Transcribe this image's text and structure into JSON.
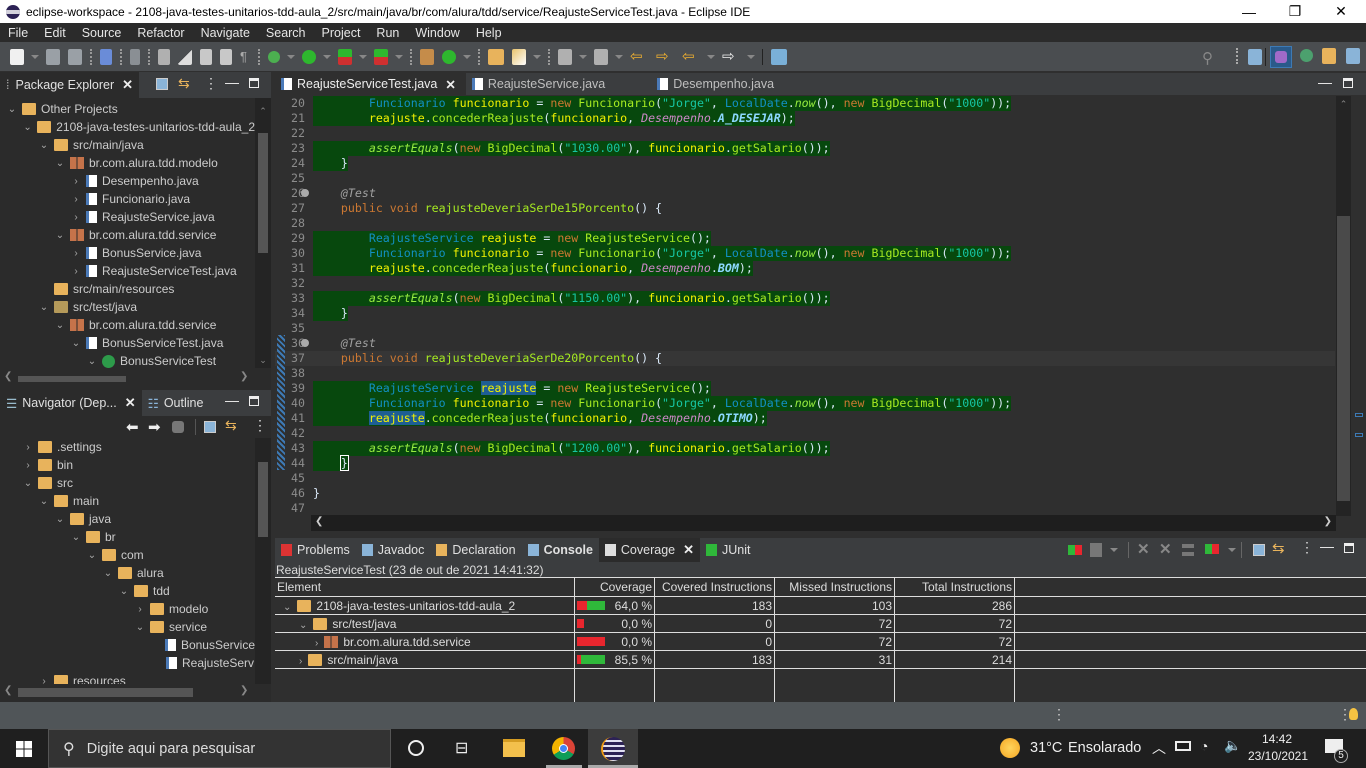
{
  "window": {
    "title": "eclipse-workspace - 2108-java-testes-unitarios-tdd-aula_2/src/main/java/br/com/alura/tdd/service/ReajusteServiceTest.java - Eclipse IDE",
    "minimize": "—",
    "maximize": "❐",
    "close": "✕"
  },
  "menu": [
    "File",
    "Edit",
    "Source",
    "Refactor",
    "Navigate",
    "Search",
    "Project",
    "Run",
    "Window",
    "Help"
  ],
  "package_explorer": {
    "title": "Package Explorer",
    "items": [
      {
        "label": "Other Projects",
        "depth": 0,
        "chev": "v",
        "icon": "working-set"
      },
      {
        "label": "2108-java-testes-unitarios-tdd-aula_2",
        "depth": 1,
        "chev": "v",
        "icon": "project"
      },
      {
        "label": "src/main/java",
        "depth": 2,
        "chev": "v",
        "icon": "source-folder"
      },
      {
        "label": "br.com.alura.tdd.modelo",
        "depth": 3,
        "chev": "v",
        "icon": "package"
      },
      {
        "label": "Desempenho.java",
        "depth": 4,
        "chev": ">",
        "icon": "java-enum-file"
      },
      {
        "label": "Funcionario.java",
        "depth": 4,
        "chev": ">",
        "icon": "java-file"
      },
      {
        "label": "ReajusteService.java",
        "depth": 4,
        "chev": ">",
        "icon": "java-file"
      },
      {
        "label": "br.com.alura.tdd.service",
        "depth": 3,
        "chev": "v",
        "icon": "package"
      },
      {
        "label": "BonusService.java",
        "depth": 4,
        "chev": ">",
        "icon": "java-file"
      },
      {
        "label": "ReajusteServiceTest.java",
        "depth": 4,
        "chev": ">",
        "icon": "java-file"
      },
      {
        "label": "src/main/resources",
        "depth": 2,
        "chev": "",
        "icon": "source-folder"
      },
      {
        "label": "src/test/java",
        "depth": 2,
        "chev": "v",
        "icon": "test-folder"
      },
      {
        "label": "br.com.alura.tdd.service",
        "depth": 3,
        "chev": "v",
        "icon": "package"
      },
      {
        "label": "BonusServiceTest.java",
        "depth": 4,
        "chev": "v",
        "icon": "java-test-file"
      },
      {
        "label": "BonusServiceTest",
        "depth": 5,
        "chev": "v",
        "icon": "class"
      }
    ]
  },
  "navigator": {
    "title": "Navigator (Dep...",
    "outline_tab": "Outline",
    "items": [
      {
        "label": ".settings",
        "depth": 0,
        "chev": ">",
        "icon": "folder"
      },
      {
        "label": "bin",
        "depth": 0,
        "chev": ">",
        "icon": "folder"
      },
      {
        "label": "src",
        "depth": 0,
        "chev": "v",
        "icon": "folder"
      },
      {
        "label": "main",
        "depth": 1,
        "chev": "v",
        "icon": "folder"
      },
      {
        "label": "java",
        "depth": 2,
        "chev": "v",
        "icon": "folder"
      },
      {
        "label": "br",
        "depth": 3,
        "chev": "v",
        "icon": "folder"
      },
      {
        "label": "com",
        "depth": 4,
        "chev": "v",
        "icon": "folder"
      },
      {
        "label": "alura",
        "depth": 5,
        "chev": "v",
        "icon": "folder"
      },
      {
        "label": "tdd",
        "depth": 6,
        "chev": "v",
        "icon": "folder"
      },
      {
        "label": "modelo",
        "depth": 7,
        "chev": ">",
        "icon": "folder"
      },
      {
        "label": "service",
        "depth": 7,
        "chev": "v",
        "icon": "folder"
      },
      {
        "label": "BonusService",
        "depth": 8,
        "chev": "",
        "icon": "java-file"
      },
      {
        "label": "ReajusteServ",
        "depth": 8,
        "chev": "",
        "icon": "java-file"
      },
      {
        "label": "resources",
        "depth": 1,
        "chev": ">",
        "icon": "folder"
      }
    ]
  },
  "editor": {
    "tabs": [
      {
        "label": "ReajusteServiceTest.java",
        "active": true
      },
      {
        "label": "ReajusteService.java",
        "active": false
      },
      {
        "label": "Desempenho.java",
        "active": false
      }
    ],
    "lines": [
      {
        "n": "20",
        "cov": true,
        "html": "        <span class='t'>Funcionario</span> <span class='v'>funcionario</span> = <span class='k'>new</span> <span class='m'>Funcionario</span>(<span class='s'>\"Jorge\"</span>, <span class='t'>LocalDate</span>.<span class='st'>now</span>(), <span class='k'>new</span> <span class='m'>BigDecimal</span>(<span class='s'>\"1000\"</span>));"
      },
      {
        "n": "21",
        "cov": true,
        "html": "        <span class='v'>reajuste</span>.<span class='m'>concederReajuste</span>(<span class='v'>funcionario</span>, <span class='e'>Desempenho</span>.<span class='f'>A_DESEJAR</span>);"
      },
      {
        "n": "22",
        "cov": false,
        "html": ""
      },
      {
        "n": "23",
        "cov": true,
        "html": "        <span class='st'>assertEquals</span>(<span class='k'>new</span> <span class='m'>BigDecimal</span>(<span class='s'>\"1030.00\"</span>), <span class='v'>funcionario</span>.<span class='m'>getSalario</span>());"
      },
      {
        "n": "24",
        "cov": true,
        "html": "    }"
      },
      {
        "n": "25",
        "cov": false,
        "html": ""
      },
      {
        "n": "26",
        "cov": false,
        "fold": true,
        "html": "    <span class='an'>@Test</span>"
      },
      {
        "n": "27",
        "cov": false,
        "html": "    <span class='k'>public</span> <span class='k'>void</span> <span class='m'>reajusteDeveriaSerDe15Porcento</span>() {"
      },
      {
        "n": "28",
        "cov": false,
        "html": ""
      },
      {
        "n": "29",
        "cov": true,
        "html": "        <span class='t'>ReajusteService</span> <span class='v'>reajuste</span> = <span class='k'>new</span> <span class='m'>ReajusteService</span>();"
      },
      {
        "n": "30",
        "cov": true,
        "html": "        <span class='t'>Funcionario</span> <span class='v'>funcionario</span> = <span class='k'>new</span> <span class='m'>Funcionario</span>(<span class='s'>\"Jorge\"</span>, <span class='t'>LocalDate</span>.<span class='st'>now</span>(), <span class='k'>new</span> <span class='m'>BigDecimal</span>(<span class='s'>\"1000\"</span>));"
      },
      {
        "n": "31",
        "cov": true,
        "html": "        <span class='v'>reajuste</span>.<span class='m'>concederReajuste</span>(<span class='v'>funcionario</span>, <span class='e'>Desempenho</span>.<span class='f'>BOM</span>);"
      },
      {
        "n": "32",
        "cov": false,
        "html": ""
      },
      {
        "n": "33",
        "cov": true,
        "html": "        <span class='st'>assertEquals</span>(<span class='k'>new</span> <span class='m'>BigDecimal</span>(<span class='s'>\"1150.00\"</span>), <span class='v'>funcionario</span>.<span class='m'>getSalario</span>());"
      },
      {
        "n": "34",
        "cov": true,
        "html": "    }"
      },
      {
        "n": "35",
        "cov": false,
        "html": ""
      },
      {
        "n": "36",
        "cov": false,
        "fold": true,
        "html": "    <span class='an'>@Test</span>"
      },
      {
        "n": "37",
        "cov": false,
        "current": true,
        "html": "    <span class='k'>public</span> <span class='k'>void</span> <span class='m'>reajusteDeveriaSerDe20Porcento</span>() {"
      },
      {
        "n": "38",
        "cov": false,
        "html": ""
      },
      {
        "n": "39",
        "cov": true,
        "html": "        <span class='t'>ReajusteService</span> <span class='v sel'>reajuste</span> = <span class='k'>new</span> <span class='m'>ReajusteService</span>();"
      },
      {
        "n": "40",
        "cov": true,
        "html": "        <span class='t'>Funcionario</span> <span class='v'>funcionario</span> = <span class='k'>new</span> <span class='m'>Funcionario</span>(<span class='s'>\"Jorge\"</span>, <span class='t'>LocalDate</span>.<span class='st'>now</span>(), <span class='k'>new</span> <span class='m'>BigDecimal</span>(<span class='s'>\"1000\"</span>));"
      },
      {
        "n": "41",
        "cov": true,
        "html": "        <span class='v sel'>reajuste</span>.<span class='m'>concederReajuste</span>(<span class='v'>funcionario</span>, <span class='e'>Desempenho</span>.<span class='f'>OTIMO</span>);"
      },
      {
        "n": "42",
        "cov": false,
        "html": ""
      },
      {
        "n": "43",
        "cov": true,
        "html": "        <span class='st'>assertEquals</span>(<span class='k'>new</span> <span class='m'>BigDecimal</span>(<span class='s'>\"1200.00\"</span>), <span class='v'>funcionario</span>.<span class='m'>getSalario</span>());"
      },
      {
        "n": "44",
        "cov": true,
        "html": "    <span style='outline:1px solid #fff'>}</span>"
      },
      {
        "n": "45",
        "cov": false,
        "html": ""
      },
      {
        "n": "46",
        "cov": false,
        "html": "}"
      },
      {
        "n": "47",
        "cov": false,
        "html": ""
      }
    ]
  },
  "bottom": {
    "tabs": [
      {
        "label": "Problems",
        "icon": "problems-icon"
      },
      {
        "label": "Javadoc",
        "icon": "javadoc-icon"
      },
      {
        "label": "Declaration",
        "icon": "declaration-icon"
      },
      {
        "label": "Console",
        "icon": "console-icon"
      },
      {
        "label": "Coverage",
        "icon": "coverage-icon",
        "active": true
      },
      {
        "label": "JUnit",
        "icon": "junit-icon"
      }
    ],
    "session": "ReajusteServiceTest (23 de out de 2021 14:41:32)",
    "columns": [
      "Element",
      "Coverage",
      "Covered Instructions",
      "Missed Instructions",
      "Total Instructions"
    ],
    "rows": [
      {
        "element": "2108-java-testes-unitarios-tdd-aula_2",
        "depth": 0,
        "chev": "v",
        "icon": "project",
        "coverage": "64,0 %",
        "covered_fraction": 0.64,
        "covered": "183",
        "missed": "103",
        "total": "286"
      },
      {
        "element": "src/test/java",
        "depth": 1,
        "chev": "v",
        "icon": "test-folder",
        "coverage": "0,0 %",
        "covered_fraction": 0.0,
        "covered": "0",
        "missed": "72",
        "total": "72"
      },
      {
        "element": "br.com.alura.tdd.service",
        "depth": 2,
        "chev": ">",
        "icon": "package",
        "coverage": "0,0 %",
        "covered_fraction": 0.0,
        "covered": "0",
        "missed": "72",
        "total": "72"
      },
      {
        "element": "src/main/java",
        "depth": 1,
        "chev": ">",
        "icon": "source-folder",
        "coverage": "85,5 %",
        "covered_fraction": 0.855,
        "covered": "183",
        "missed": "31",
        "total": "214"
      }
    ],
    "colors": {
      "covered": "#2fb83a",
      "missed": "#e8262e"
    }
  },
  "taskbar": {
    "search_placeholder": "Digite aqui para pesquisar",
    "weather_temp": "31°C",
    "weather_text": "Ensolarado",
    "time": "14:42",
    "date": "23/10/2021",
    "notifications": "5"
  },
  "colors": {
    "coverage_line": "#07480d",
    "selection": "#1e5e93"
  }
}
